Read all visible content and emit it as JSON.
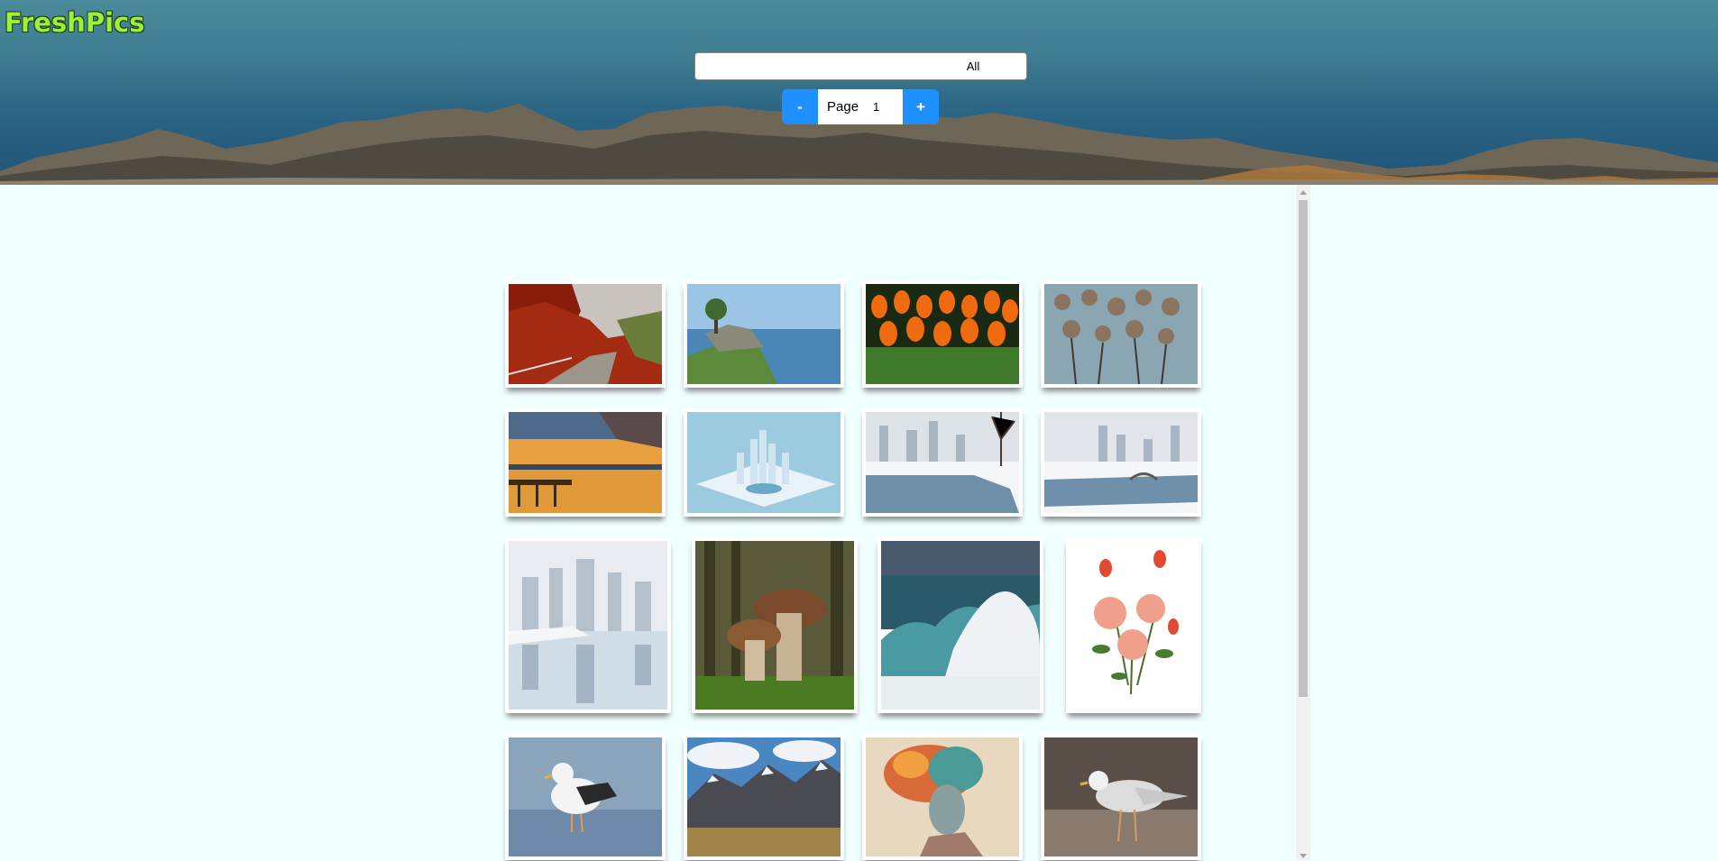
{
  "header": {
    "logo": "FreshPics",
    "filter": {
      "selected": "All"
    },
    "pager": {
      "minus": "-",
      "plus": "+",
      "label": "Page",
      "page": "1"
    }
  },
  "gallery": [
    {
      "name": "autumn-road-photo"
    },
    {
      "name": "coastal-island-photo"
    },
    {
      "name": "tulips-photo"
    },
    {
      "name": "dried-flowers-photo"
    },
    {
      "name": "sunset-pier-photo"
    },
    {
      "name": "ice-city-photo"
    },
    {
      "name": "winter-city-river-photo"
    },
    {
      "name": "winter-city-bridge-photo"
    },
    {
      "name": "winter-skyline-reflection-photo"
    },
    {
      "name": "mushrooms-photo"
    },
    {
      "name": "ocean-wave-photo"
    },
    {
      "name": "roses-bouquet-photo"
    },
    {
      "name": "seagull-water-photo"
    },
    {
      "name": "mountain-range-photo"
    },
    {
      "name": "woman-flower-hair-photo"
    },
    {
      "name": "seagull-beach-photo"
    }
  ]
}
